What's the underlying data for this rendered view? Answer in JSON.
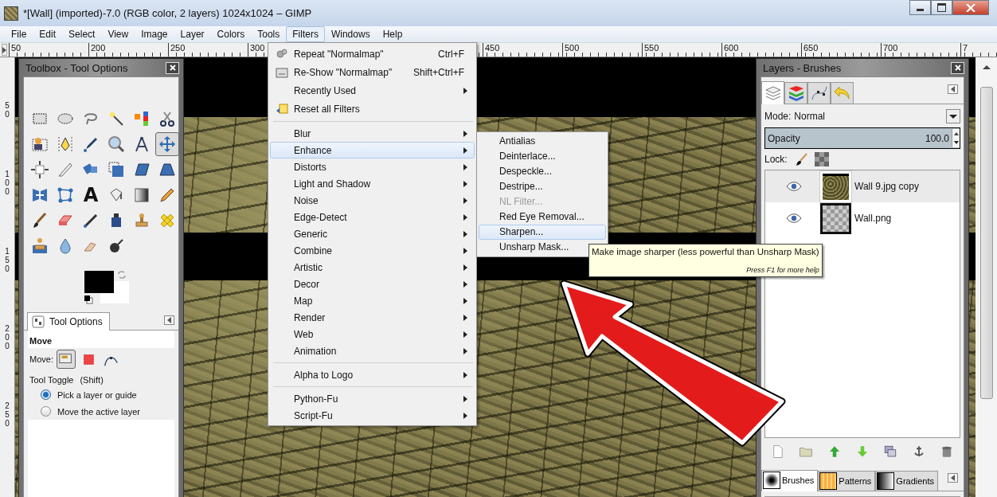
{
  "window": {
    "title": "*[Wall] (imported)-7.0 (RGB color, 2 layers) 1024x1024 – GIMP"
  },
  "menubar": [
    {
      "label": "File",
      "selected": false
    },
    {
      "label": "Edit",
      "selected": false
    },
    {
      "label": "Select",
      "selected": false
    },
    {
      "label": "View",
      "selected": false
    },
    {
      "label": "Image",
      "selected": false
    },
    {
      "label": "Layer",
      "selected": false
    },
    {
      "label": "Colors",
      "selected": false
    },
    {
      "label": "Tools",
      "selected": false
    },
    {
      "label": "Filters",
      "selected": true
    },
    {
      "label": "Windows",
      "selected": false
    },
    {
      "label": "Help",
      "selected": false
    }
  ],
  "ruler": {
    "left_labels": [
      "50",
      "200",
      "250",
      "300"
    ],
    "right_labels": [
      "450",
      "500",
      "550",
      "600",
      "650",
      "700",
      "7"
    ],
    "side_labels": [
      "50",
      "100",
      "150",
      "200",
      "250"
    ]
  },
  "toolbox": {
    "title": "Toolbox - Tool Options",
    "tools": [
      {
        "selected": false
      },
      {
        "selected": false
      },
      {
        "selected": false
      },
      {
        "selected": false
      },
      {
        "selected": false
      },
      {
        "selected": false
      },
      {
        "selected": false
      },
      {
        "selected": false
      },
      {
        "selected": false
      },
      {
        "selected": false
      },
      {
        "selected": false
      },
      {
        "selected": true
      },
      {
        "selected": false
      },
      {
        "selected": false
      },
      {
        "selected": false
      },
      {
        "selected": false
      },
      {
        "selected": false
      },
      {
        "selected": false
      },
      {
        "selected": false
      },
      {
        "selected": false
      },
      {
        "selected": false,
        "glyph": "A"
      },
      {
        "selected": false
      },
      {
        "selected": false
      },
      {
        "selected": false
      },
      {
        "selected": false
      },
      {
        "selected": false
      },
      {
        "selected": false
      },
      {
        "selected": false
      },
      {
        "selected": false
      },
      {
        "selected": false
      },
      {
        "selected": false
      },
      {
        "selected": false
      },
      {
        "selected": false
      },
      {
        "selected": false
      }
    ],
    "options": {
      "tab_label": "Tool Options",
      "tool_name": "Move",
      "move_label": "Move:",
      "move_modes": [
        {
          "selected": true
        },
        {
          "selected": false
        },
        {
          "selected": false
        }
      ],
      "toggle_label": "Tool Toggle",
      "toggle_key": "(Shift)",
      "radios": [
        {
          "label": "Pick a layer or guide",
          "selected": true
        },
        {
          "label": "Move the active layer",
          "selected": false
        }
      ]
    }
  },
  "layers_panel": {
    "title": "Layers - Brushes",
    "tabs": [
      {
        "selected": true
      },
      {
        "selected": false
      },
      {
        "selected": false
      },
      {
        "selected": false
      }
    ],
    "mode_label": "Mode:",
    "mode_value": "Normal",
    "opacity": {
      "label": "Opacity",
      "value": "100.0",
      "level": 1
    },
    "lock_label": "Lock:",
    "layers": [
      {
        "name": "Wall 9.jpg copy",
        "selected": true,
        "visible": true,
        "kind": "photo"
      },
      {
        "name": "Wall.png",
        "selected": false,
        "visible": true,
        "kind": "transparent"
      }
    ],
    "bottom_tabs": [
      {
        "label": "Brushes",
        "selected": true,
        "kind": "brush"
      },
      {
        "label": "Patterns",
        "selected": false,
        "kind": "pattern"
      },
      {
        "label": "Gradients",
        "selected": false,
        "kind": "gradient"
      }
    ]
  },
  "filters_menu": {
    "entries": [
      {
        "kind": "item",
        "label": "Repeat \"Normalmap\"",
        "shortcut": "Ctrl+F",
        "submenu": false,
        "selected": false
      },
      {
        "kind": "item",
        "label": "Re-Show \"Normalmap\"",
        "shortcut": "Shift+Ctrl+F",
        "submenu": false,
        "selected": false
      },
      {
        "kind": "item",
        "label": "Recently Used",
        "submenu": true,
        "selected": false
      },
      {
        "kind": "item",
        "label": "Reset all Filters",
        "submenu": false,
        "selected": false
      },
      {
        "kind": "separator"
      },
      {
        "kind": "item",
        "label": "Blur",
        "submenu": true,
        "selected": false
      },
      {
        "kind": "item",
        "label": "Enhance",
        "submenu": true,
        "selected": true
      },
      {
        "kind": "item",
        "label": "Distorts",
        "submenu": true,
        "selected": false
      },
      {
        "kind": "item",
        "label": "Light and Shadow",
        "submenu": true,
        "selected": false
      },
      {
        "kind": "item",
        "label": "Noise",
        "submenu": true,
        "selected": false
      },
      {
        "kind": "item",
        "label": "Edge-Detect",
        "submenu": true,
        "selected": false
      },
      {
        "kind": "item",
        "label": "Generic",
        "submenu": true,
        "selected": false
      },
      {
        "kind": "item",
        "label": "Combine",
        "submenu": true,
        "selected": false
      },
      {
        "kind": "item",
        "label": "Artistic",
        "submenu": true,
        "selected": false
      },
      {
        "kind": "item",
        "label": "Decor",
        "submenu": true,
        "selected": false
      },
      {
        "kind": "item",
        "label": "Map",
        "submenu": true,
        "selected": false
      },
      {
        "kind": "item",
        "label": "Render",
        "submenu": true,
        "selected": false
      },
      {
        "kind": "item",
        "label": "Web",
        "submenu": true,
        "selected": false
      },
      {
        "kind": "item",
        "label": "Animation",
        "submenu": true,
        "selected": false
      },
      {
        "kind": "separator"
      },
      {
        "kind": "item",
        "label": "Alpha to Logo",
        "submenu": true,
        "selected": false
      },
      {
        "kind": "separator"
      },
      {
        "kind": "item",
        "label": "Python-Fu",
        "submenu": true,
        "selected": false
      },
      {
        "kind": "item",
        "label": "Script-Fu",
        "submenu": true,
        "selected": false
      }
    ]
  },
  "enhance_submenu": {
    "items": [
      {
        "label": "Antialias",
        "selected": false,
        "disabled": false
      },
      {
        "label": "Deinterlace...",
        "selected": false,
        "disabled": false
      },
      {
        "label": "Despeckle...",
        "selected": false,
        "disabled": false
      },
      {
        "label": "Destripe...",
        "selected": false,
        "disabled": false
      },
      {
        "label": "NL Filter...",
        "selected": false,
        "disabled": true
      },
      {
        "label": "Red Eye Removal...",
        "selected": false,
        "disabled": false
      },
      {
        "label": "Sharpen...",
        "selected": true,
        "disabled": false
      },
      {
        "label": "Unsharp Mask...",
        "selected": false,
        "disabled": false
      }
    ]
  },
  "tooltip": {
    "text": "Make image sharper (less powerful than Unsharp Mask)",
    "hint": "Press F1 for more help"
  }
}
